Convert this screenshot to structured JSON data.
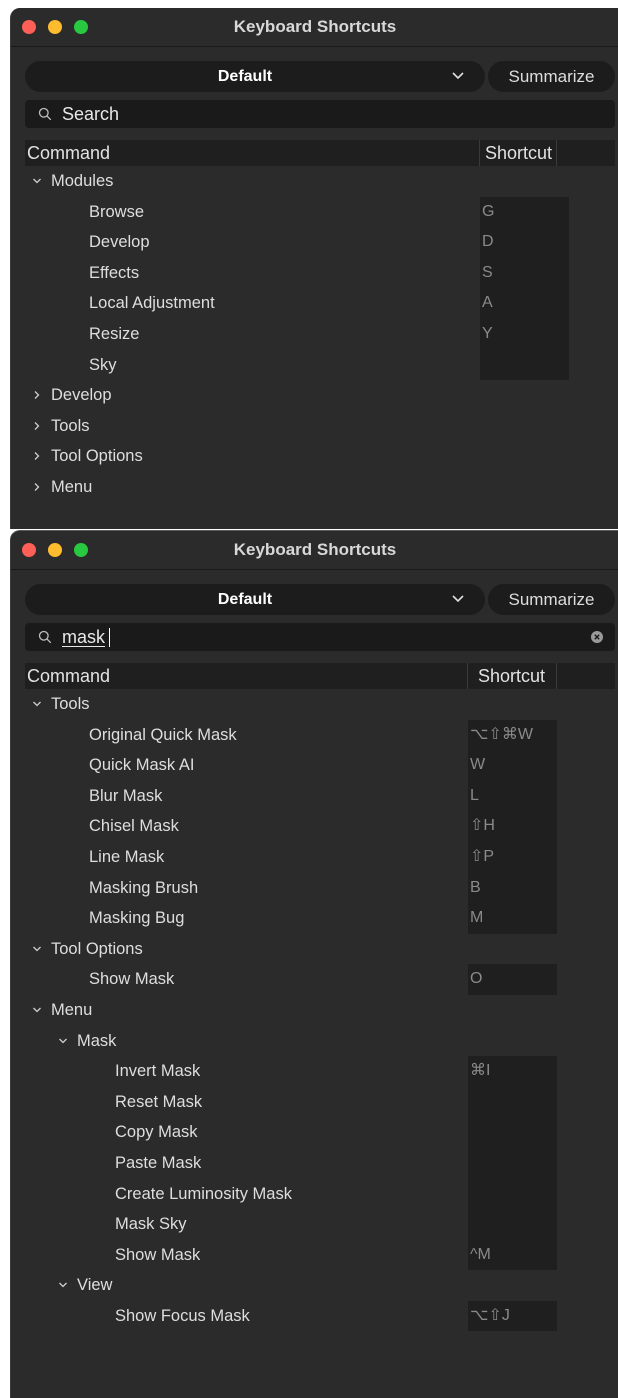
{
  "windows": [
    {
      "title": "Keyboard Shortcuts",
      "preset": "Default",
      "summarize_label": "Summarize",
      "search": {
        "value": "",
        "placeholder": "Search"
      },
      "columns": {
        "command": "Command",
        "shortcut": "Shortcut"
      },
      "rows": [
        {
          "label": "Modules",
          "level": 0,
          "expanded": true
        },
        {
          "label": "Browse",
          "level": 2,
          "shortcut": "G"
        },
        {
          "label": "Develop",
          "level": 2,
          "shortcut": "D"
        },
        {
          "label": "Effects",
          "level": 2,
          "shortcut": "S"
        },
        {
          "label": "Local Adjustment",
          "level": 2,
          "shortcut": "A"
        },
        {
          "label": "Resize",
          "level": 2,
          "shortcut": "Y"
        },
        {
          "label": "Sky",
          "level": 2,
          "shortcut": ""
        },
        {
          "label": "Develop",
          "level": 0,
          "expanded": false
        },
        {
          "label": "Tools",
          "level": 0,
          "expanded": false
        },
        {
          "label": "Tool Options",
          "level": 0,
          "expanded": false
        },
        {
          "label": "Menu",
          "level": 0,
          "expanded": false
        }
      ]
    },
    {
      "title": "Keyboard Shortcuts",
      "preset": "Default",
      "summarize_label": "Summarize",
      "search": {
        "value": "mask",
        "placeholder": "Search"
      },
      "columns": {
        "command": "Command",
        "shortcut": "Shortcut"
      },
      "rows": [
        {
          "label": "Tools",
          "level": 0,
          "expanded": true
        },
        {
          "label": "Original Quick Mask",
          "level": 2,
          "shortcut": "⌥⇧⌘W"
        },
        {
          "label": "Quick Mask AI",
          "level": 2,
          "shortcut": "W"
        },
        {
          "label": "Blur Mask",
          "level": 2,
          "shortcut": "L"
        },
        {
          "label": "Chisel Mask",
          "level": 2,
          "shortcut": "⇧H"
        },
        {
          "label": "Line Mask",
          "level": 2,
          "shortcut": "⇧P"
        },
        {
          "label": "Masking Brush",
          "level": 2,
          "shortcut": "B"
        },
        {
          "label": "Masking Bug",
          "level": 2,
          "shortcut": "M"
        },
        {
          "label": "Tool Options",
          "level": 0,
          "expanded": true
        },
        {
          "label": "Show Mask",
          "level": 2,
          "shortcut": "O"
        },
        {
          "label": "Menu",
          "level": 0,
          "expanded": true
        },
        {
          "label": "Mask",
          "level": 1,
          "expanded": true
        },
        {
          "label": "Invert Mask",
          "level": 3,
          "shortcut": "⌘I"
        },
        {
          "label": "Reset Mask",
          "level": 3,
          "shortcut": ""
        },
        {
          "label": "Copy Mask",
          "level": 3,
          "shortcut": ""
        },
        {
          "label": "Paste Mask",
          "level": 3,
          "shortcut": ""
        },
        {
          "label": "Create Luminosity Mask",
          "level": 3,
          "shortcut": ""
        },
        {
          "label": "Mask Sky",
          "level": 3,
          "shortcut": ""
        },
        {
          "label": "Show Mask",
          "level": 3,
          "shortcut": "^M"
        },
        {
          "label": "View",
          "level": 1,
          "expanded": true
        },
        {
          "label": "Show Focus Mask",
          "level": 3,
          "shortcut": "⌥⇧J"
        }
      ]
    }
  ],
  "colors": {
    "window_bg": "#2b2b2b",
    "field_bg": "#1c1c1c",
    "close": "#fe5f57",
    "minimize": "#febc2e",
    "zoom": "#28c840",
    "shortcut_text": "#8a8a8a"
  }
}
